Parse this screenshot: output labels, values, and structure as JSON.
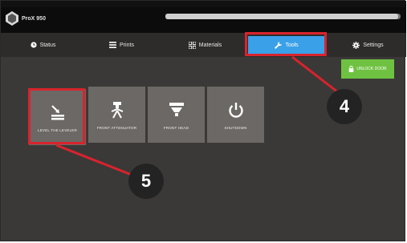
{
  "app": {
    "title": "ProX 950"
  },
  "print_progress": 0.99,
  "tabs": [
    {
      "label": "Status",
      "icon": "clock-icon"
    },
    {
      "label": "Prints",
      "icon": "list-icon"
    },
    {
      "label": "Materials",
      "icon": "materials-icon"
    },
    {
      "label": "Tools",
      "icon": "wrench-icon",
      "active": true
    },
    {
      "label": "Settings",
      "icon": "gear-icon"
    }
  ],
  "unlock_button": {
    "label": "UNLOCK DOOR",
    "icon": "lock-icon"
  },
  "tool_tiles": [
    {
      "label": "LEVEL THE LEVELER",
      "icon": "leveler-icon"
    },
    {
      "label": "FRONT ATTENUATOR",
      "icon": "attenuator-icon"
    },
    {
      "label": "FRONT HEAD",
      "icon": "front-head-icon"
    },
    {
      "label": "SHUTDOWN",
      "icon": "power-icon"
    }
  ],
  "callouts": [
    "4",
    "5"
  ],
  "colors": {
    "active_tab": "#3aa0e8",
    "unlock": "#6fc241",
    "highlight": "#d9232d",
    "tile": "#6b6865"
  }
}
